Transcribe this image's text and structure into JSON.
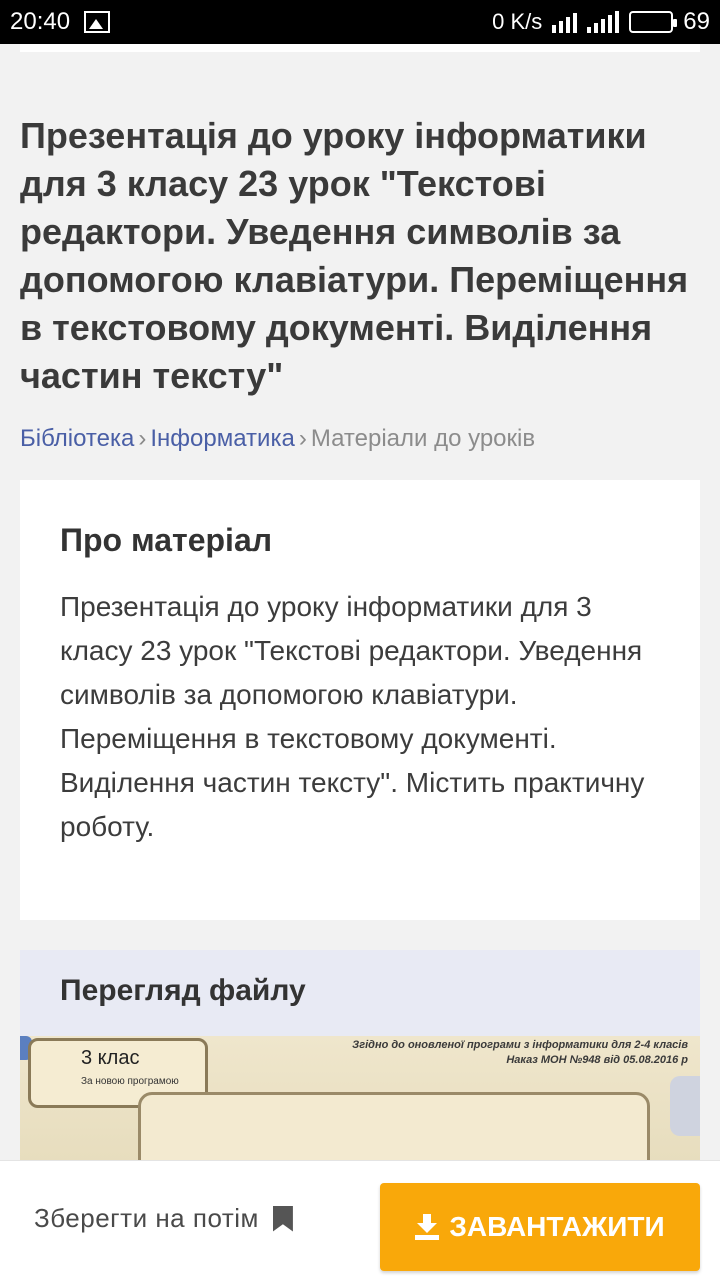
{
  "status_bar": {
    "time": "20:40",
    "net_speed": "0 K/s",
    "battery": "69"
  },
  "page": {
    "title": "Презентація до уроку інформатики для 3 класу 23 урок \"Текстові редактори. Уведення символів за допомогою клавіатури. Переміщення в текстовому документі. Виділення частин тексту\"",
    "breadcrumb": [
      "Бібліотека",
      "Інформатика",
      "Матеріали до уроків"
    ]
  },
  "about": {
    "heading": "Про матеріал",
    "text": "Презентація до уроку інформатики для 3 класу 23 урок \"Текстові редактори. Уведення символів за допомогою клавіатури. Переміщення в текстовому документі. Виділення частин тексту\". Містить практичну роботу."
  },
  "preview": {
    "heading": "Перегляд файлу",
    "slide_class": "3 клас",
    "slide_subtitle": "За новою програмою",
    "slide_note": "Згідно до оновленої програми з інформатики для 2-4 класів Наказ МОН №948 від 05.08.2016 р"
  },
  "actions": {
    "save_later": "Зберегти на потім",
    "download": "ЗАВАНТАЖИТИ"
  }
}
